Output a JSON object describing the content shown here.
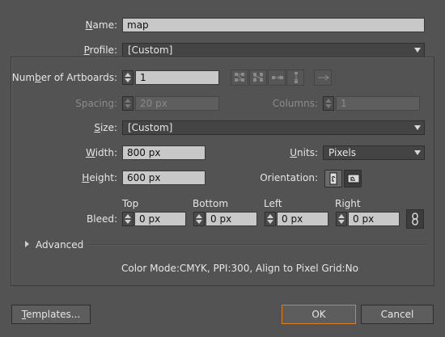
{
  "name": {
    "label": "Name:",
    "value": "map"
  },
  "profile": {
    "label": "Profile:",
    "value": "[Custom]"
  },
  "artboards": {
    "label": "Number of Artboards:",
    "value": "1"
  },
  "spacing": {
    "label": "Spacing:",
    "value": "20 px"
  },
  "columns": {
    "label": "Columns:",
    "value": "1"
  },
  "size": {
    "label": "Size:",
    "value": "[Custom]"
  },
  "width": {
    "label": "Width:",
    "value": "800 px"
  },
  "units": {
    "label": "Units:",
    "value": "Pixels"
  },
  "height": {
    "label": "Height:",
    "value": "600 px"
  },
  "orientation": {
    "label": "Orientation:"
  },
  "bleed": {
    "label": "Bleed:",
    "top": {
      "header": "Top",
      "value": "0 px"
    },
    "bottom": {
      "header": "Bottom",
      "value": "0 px"
    },
    "left": {
      "header": "Left",
      "value": "0 px"
    },
    "right": {
      "header": "Right",
      "value": "0 px"
    }
  },
  "advanced": {
    "label": "Advanced"
  },
  "summary": "Color Mode:CMYK, PPI:300, Align to Pixel Grid:No",
  "buttons": {
    "templates": "Templates...",
    "ok": "OK",
    "cancel": "Cancel"
  }
}
